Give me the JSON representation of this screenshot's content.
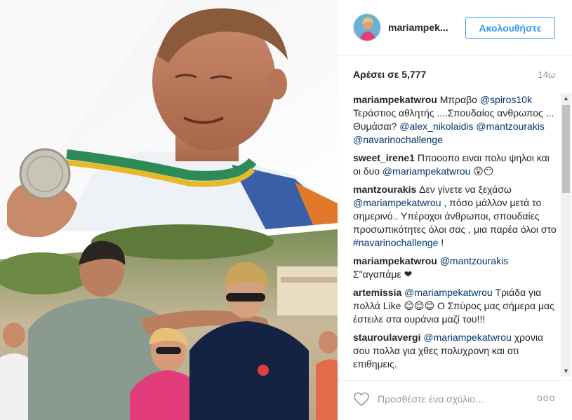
{
  "post": {
    "username": "mariampek...",
    "follow_label": "Ακολουθήστε",
    "likes": "Αρέσει σε 5,777",
    "time_ago": "14ω"
  },
  "comments": [
    {
      "parts": [
        {
          "t": "author",
          "v": "mariampekatwrou"
        },
        {
          "t": "text",
          "v": " Μπραβο "
        },
        {
          "t": "mention",
          "v": "@spiros10k"
        },
        {
          "t": "text",
          "v": " Τεράστιος αθλητής ....Σπουδαίος ανθρωπος ... Θυμάσαι? "
        },
        {
          "t": "mention",
          "v": "@alex_nikolaidis"
        },
        {
          "t": "text",
          "v": " "
        },
        {
          "t": "mention",
          "v": "@mantzourakis"
        },
        {
          "t": "text",
          "v": " "
        },
        {
          "t": "mention",
          "v": "@navarinochallenge"
        }
      ]
    },
    {
      "parts": [
        {
          "t": "author",
          "v": "sweet_irene1"
        },
        {
          "t": "text",
          "v": " Πποοοπο ειναι πολυ ψηλοι και οι δυο "
        },
        {
          "t": "mention",
          "v": "@mariampekatwrou"
        },
        {
          "t": "text",
          "v": " 😲😶"
        }
      ]
    },
    {
      "parts": [
        {
          "t": "author",
          "v": "mantzourakis"
        },
        {
          "t": "text",
          "v": " Δεν γίνετε να ξεχάσω "
        },
        {
          "t": "mention",
          "v": "@mariampekatwrou"
        },
        {
          "t": "text",
          "v": " , πόσο μάλλον μετά το σημερινό.. Υπέροχοι άνθρωποι, σπουδαίες προσωπικότητες όλοι σας , μια παρέα όλοι στο "
        },
        {
          "t": "mention",
          "v": "#navarinochallenge"
        },
        {
          "t": "text",
          "v": " !"
        }
      ]
    },
    {
      "parts": [
        {
          "t": "author",
          "v": "mariampekatwrou"
        },
        {
          "t": "text",
          "v": " "
        },
        {
          "t": "mention",
          "v": "@mantzourakis"
        },
        {
          "t": "text",
          "v": " Σ\"αγαπάμε ❤"
        }
      ]
    },
    {
      "parts": [
        {
          "t": "author",
          "v": "artemissia"
        },
        {
          "t": "text",
          "v": " "
        },
        {
          "t": "mention",
          "v": "@mariampekatwrou"
        },
        {
          "t": "text",
          "v": " Τριάδα για πολλά Like 😊😊😊 Ο Σπύρος μας σήμερα μας έστειλε στα ουράνια μαζί του!!!"
        }
      ]
    },
    {
      "parts": [
        {
          "t": "author",
          "v": "stauroulavergi"
        },
        {
          "t": "text",
          "v": " "
        },
        {
          "t": "mention",
          "v": "@mariampekatwrou"
        },
        {
          "t": "text",
          "v": " χρονια σου πολλα για χθες πολυχρονη και οτι επιθημεις."
        }
      ]
    }
  ],
  "footer": {
    "comment_placeholder": "Προσθέστε ένα σχόλιο...",
    "more_label": "ooo"
  },
  "scrollbar": {
    "up_arrow": "▲",
    "down_arrow": "▼"
  }
}
